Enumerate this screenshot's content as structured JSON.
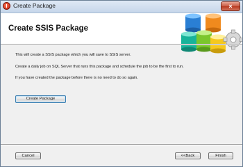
{
  "window": {
    "title": "Create Package",
    "close_glyph": "×"
  },
  "header": {
    "title": "Create SSIS Package"
  },
  "body": {
    "lines": [
      "This will create a SSIS package which you will save to SSIS  server.",
      "Create a daily job on SQL Server that runs this package and schedule the job to be the first to run.",
      "If you have created the package before there is no need to do so again."
    ],
    "create_button_label": "Create Package"
  },
  "footer": {
    "cancel_label": "Cancel",
    "back_label": "<<Back",
    "finish_label": "Finish"
  },
  "colors": {
    "title_bar": "#c6d6ea",
    "close_button": "#c75b44",
    "header_background": "#ffffff",
    "dialog_background": "#f0f0f0"
  },
  "icons": [
    "app-icon",
    "close-icon",
    "database-cylinders-icon",
    "gear-icon"
  ]
}
